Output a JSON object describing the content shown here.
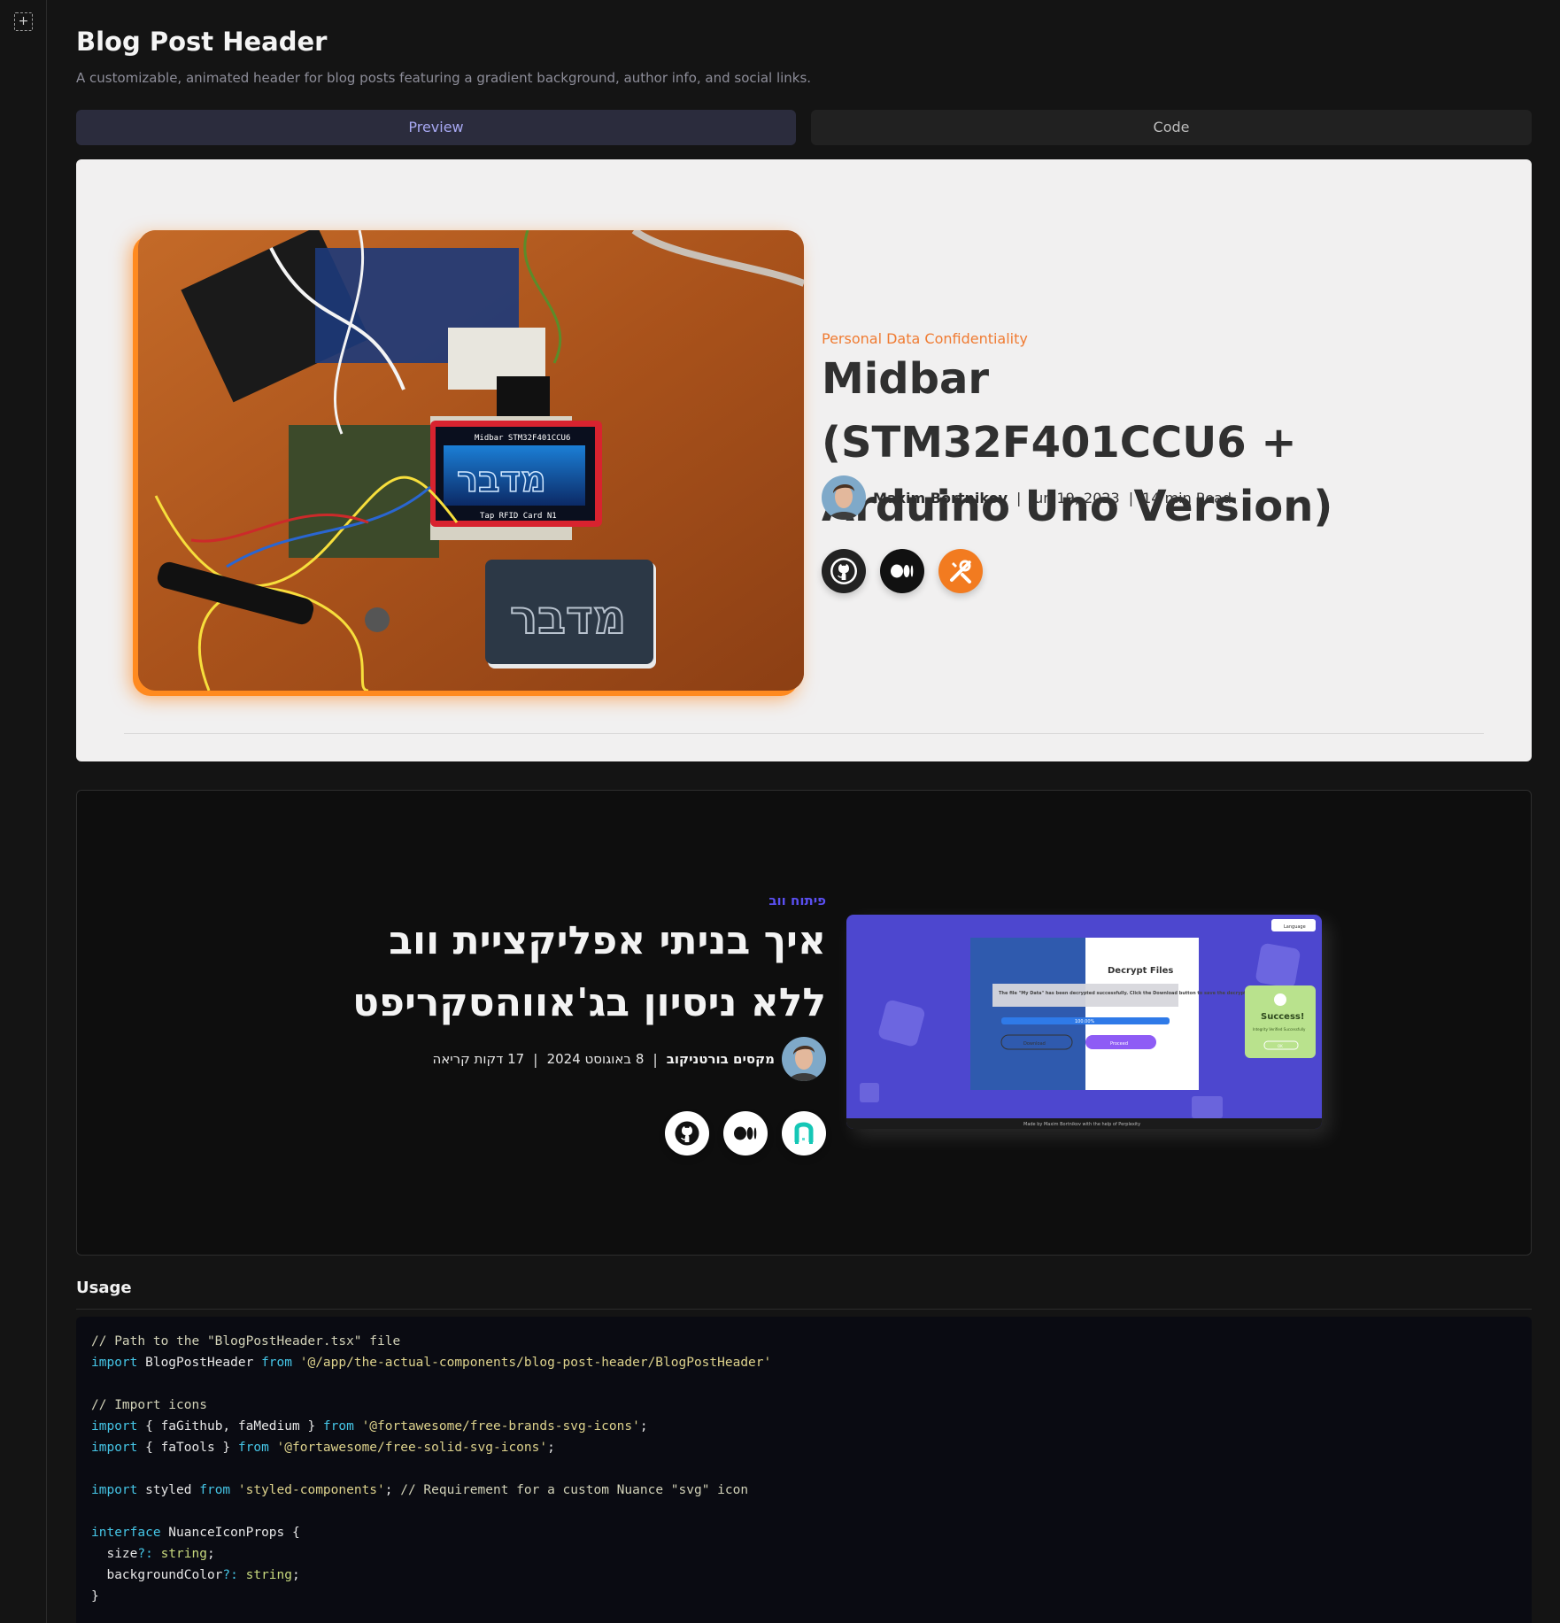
{
  "page": {
    "title": "Blog Post Header",
    "subtitle": "A customizable, animated header for blog posts featuring a gradient background, author info, and social links."
  },
  "tabs": [
    {
      "label": "Preview"
    },
    {
      "label": "Code"
    }
  ],
  "preview_light": {
    "category": "Personal Data Confidentiality",
    "title": "Midbar (STM32F401CCU6 + Arduino Uno Version)",
    "author": "Maxim Bortnikov",
    "date": "Jun 19, 2023",
    "read_time": "14 min Read",
    "separator": "|",
    "hero_image_texts": {
      "display_top": "Midbar STM32F401CCU6",
      "display_bottom": "Tap RFID Card N1",
      "card_text": "מדבר",
      "screen_text": "מדבר"
    },
    "social": [
      "github-icon",
      "medium-icon",
      "tools-icon"
    ],
    "accent": "#f07b32"
  },
  "preview_dark": {
    "category": "פיתוח ווב",
    "title": "איך בניתי אפליקציית ווב ללא ניסיון בג'אווהסקריפט",
    "author": "מקסים בורטניקוב",
    "date": "8 באוגוסט 2024",
    "read_time": "17 דקות קריאה",
    "separator": "|",
    "social": [
      "github-icon",
      "medium-icon",
      "nuance-icon"
    ],
    "accent": "#5a4ff0",
    "screenshot_texts": {
      "language": "Language",
      "panel_title": "Decrypt Files",
      "message": "The file \"My Data\" has been decrypted successfully. Click the Download button to save the decrypted file.",
      "progress": "100.00%",
      "left_button": "Download",
      "right_button": "Proceed",
      "success_title": "Success!",
      "success_text": "Integrity Verified Successfully",
      "success_button": "OK",
      "footer": "Made by Maxim Bortnikov with the help of Perplexity"
    }
  },
  "usage": {
    "heading": "Usage",
    "code_lines": [
      [
        {
          "t": "// Path to the \"BlogPostHeader.tsx\" file",
          "k": "comment"
        }
      ],
      [
        {
          "t": "import",
          "k": "key"
        },
        {
          "t": " BlogPostHeader ",
          "k": "plain"
        },
        {
          "t": "from",
          "k": "key"
        },
        {
          "t": " ",
          "k": "plain"
        },
        {
          "t": "'@/app/the-actual-components/blog-post-header/BlogPostHeader'",
          "k": "str"
        }
      ],
      [],
      [
        {
          "t": "// Import icons",
          "k": "comment"
        }
      ],
      [
        {
          "t": "import",
          "k": "key"
        },
        {
          "t": " { faGithub, faMedium } ",
          "k": "plain"
        },
        {
          "t": "from",
          "k": "key"
        },
        {
          "t": " ",
          "k": "plain"
        },
        {
          "t": "'@fortawesome/free-brands-svg-icons'",
          "k": "str"
        },
        {
          "t": ";",
          "k": "plain"
        }
      ],
      [
        {
          "t": "import",
          "k": "key"
        },
        {
          "t": " { faTools } ",
          "k": "plain"
        },
        {
          "t": "from",
          "k": "key"
        },
        {
          "t": " ",
          "k": "plain"
        },
        {
          "t": "'@fortawesome/free-solid-svg-icons'",
          "k": "str"
        },
        {
          "t": ";",
          "k": "plain"
        }
      ],
      [],
      [
        {
          "t": "import",
          "k": "key"
        },
        {
          "t": " styled ",
          "k": "plain"
        },
        {
          "t": "from",
          "k": "key"
        },
        {
          "t": " ",
          "k": "plain"
        },
        {
          "t": "'styled-components'",
          "k": "str"
        },
        {
          "t": "; ",
          "k": "plain"
        },
        {
          "t": "// Requirement for a custom Nuance \"svg\" icon",
          "k": "comment"
        }
      ],
      [],
      [
        {
          "t": "interface",
          "k": "key"
        },
        {
          "t": " NuanceIconProps {",
          "k": "plain"
        }
      ],
      [
        {
          "t": "  size",
          "k": "plain"
        },
        {
          "t": "?:",
          "k": "key"
        },
        {
          "t": " ",
          "k": "plain"
        },
        {
          "t": "string",
          "k": "type"
        },
        {
          "t": ";",
          "k": "plain"
        }
      ],
      [
        {
          "t": "  backgroundColor",
          "k": "plain"
        },
        {
          "t": "?:",
          "k": "key"
        },
        {
          "t": " ",
          "k": "plain"
        },
        {
          "t": "string",
          "k": "type"
        },
        {
          "t": ";",
          "k": "plain"
        }
      ],
      [
        {
          "t": "}",
          "k": "plain"
        }
      ]
    ]
  },
  "icons": {
    "sidebar_toggle": "sidebar-expand-icon"
  },
  "colors": {
    "background": "#141414",
    "light_card": "#f1f0f0",
    "dark_card": "#0e0e0e",
    "code_bg": "#0a0b12",
    "tab_active": "#2b2c3d"
  }
}
